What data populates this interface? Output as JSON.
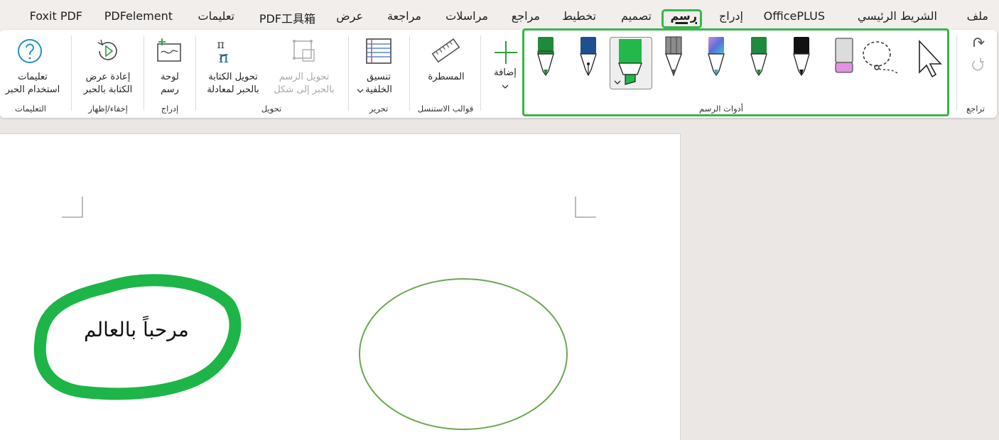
{
  "menu": {
    "items": [
      {
        "label": "ملف",
        "active": false
      },
      {
        "label": "الشريط الرئيسي",
        "active": false
      },
      {
        "label": "OfficePLUS",
        "active": false
      },
      {
        "label": "إدراج",
        "active": false
      },
      {
        "label": "رسم",
        "active": true
      },
      {
        "label": "تصميم",
        "active": false
      },
      {
        "label": "تخطيط",
        "active": false
      },
      {
        "label": "مراجع",
        "active": false
      },
      {
        "label": "مراسلات",
        "active": false
      },
      {
        "label": "مراجعة",
        "active": false
      },
      {
        "label": "عرض",
        "active": false
      },
      {
        "label": "PDF工具箱",
        "active": false
      },
      {
        "label": "تعليمات",
        "active": false
      },
      {
        "label": "PDFelement",
        "active": false
      },
      {
        "label": "Foxit PDF",
        "active": false
      }
    ]
  },
  "ribbon": {
    "groups": {
      "undo": "تراجع",
      "drawing_tools": "أدوات الرسم",
      "stencils": "قوالب الاستنسل",
      "edit": "تحرير",
      "convert": "تحويل",
      "insert": "إدراج",
      "show_hide": "إخفاء/إظهار",
      "help": "التعليمات"
    },
    "buttons": {
      "add": "إضافة",
      "ruler": "المسطرة",
      "format_background": "تنسيق\nالخلفية",
      "ink_to_shape": "تحويل الرسم\nبالحبر إلى شكل",
      "ink_to_math": "تحويل الكتابة\nبالحبر لمعادلة",
      "drawing_canvas": "لوحة\nرسم",
      "ink_replay": "إعادة عرض\nالكتابة بالحبر",
      "ink_help": "تعليمات\nاستخدام الحبر"
    },
    "pens": [
      {
        "name": "select-cursor-icon"
      },
      {
        "name": "lasso-select-icon"
      },
      {
        "name": "eraser-icon"
      },
      {
        "name": "black-pen-icon",
        "color": "#111111"
      },
      {
        "name": "green-pen-icon",
        "color": "#1e8a3c"
      },
      {
        "name": "galaxy-pen-icon",
        "color": "#5b6fd6"
      },
      {
        "name": "pencil-icon",
        "color": "#777777"
      },
      {
        "name": "green-highlighter-icon",
        "color": "#22b84b",
        "selected": true
      },
      {
        "name": "blue-fountain-pen-icon",
        "color": "#1d4f91"
      },
      {
        "name": "green-marker-icon",
        "color": "#1e8a3c"
      }
    ]
  },
  "document": {
    "text": "مرحباً بالعالم",
    "colors": {
      "highlight": "#1db547",
      "ellipse": "#6aa84f"
    }
  }
}
